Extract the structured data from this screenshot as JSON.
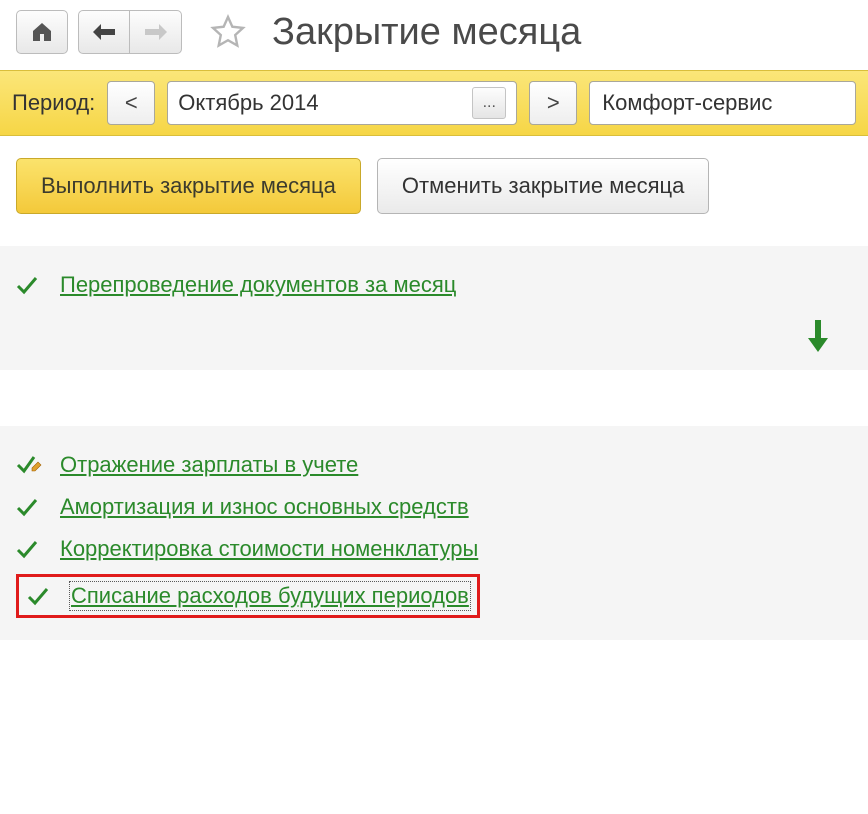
{
  "header": {
    "title": "Закрытие месяца"
  },
  "period_bar": {
    "label": "Период:",
    "prev": "<",
    "next": ">",
    "value": "Октябрь 2014",
    "dots": "...",
    "org": "Комфорт-сервис"
  },
  "actions": {
    "execute": "Выполнить закрытие месяца",
    "cancel": "Отменить закрытие месяца"
  },
  "operations": {
    "first": "Перепроведение документов за месяц",
    "items": [
      "Отражение зарплаты в учете",
      "Амортизация и износ основных средств",
      "Корректировка стоимости номенклатуры"
    ],
    "highlighted": "Списание расходов будущих периодов"
  }
}
